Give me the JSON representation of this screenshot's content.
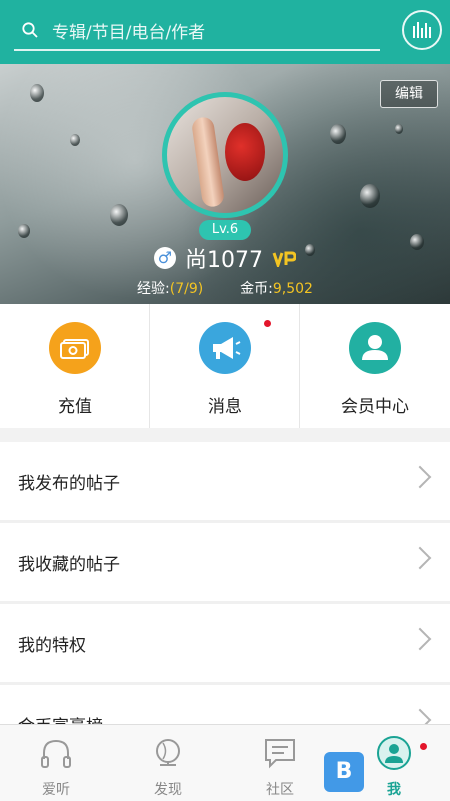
{
  "search": {
    "placeholder": "专辑/节目/电台/作者"
  },
  "profile": {
    "edit_label": "编辑",
    "level": "Lv.6",
    "username": "尚1077",
    "gender_symbol": "♂",
    "exp_label": "经验:",
    "exp_value": "(7/9)",
    "coins_label": "金币:",
    "coins_value": "9,502"
  },
  "quick_actions": [
    {
      "label": "充值",
      "icon": "wallet-icon",
      "color": "#f5a21b"
    },
    {
      "label": "消息",
      "icon": "megaphone-icon",
      "color": "#3aa6dd",
      "badge": true
    },
    {
      "label": "会员中心",
      "icon": "member-icon",
      "color": "#22b0a2"
    }
  ],
  "menu": [
    {
      "label": "我发布的帖子"
    },
    {
      "label": "我收藏的帖子"
    },
    {
      "label": "我的特权"
    },
    {
      "label": "金币富豪榜"
    }
  ],
  "bottom_nav": [
    {
      "label": "爱听",
      "icon": "headphones-icon",
      "active": false
    },
    {
      "label": "发现",
      "icon": "globe-icon",
      "active": false
    },
    {
      "label": "社区",
      "icon": "chat-icon",
      "active": false
    },
    {
      "label": "我",
      "icon": "user-icon",
      "active": true,
      "badge": true
    }
  ],
  "colors": {
    "accent": "#20b2a0",
    "gold": "#f3c423",
    "badge_red": "#e3162b"
  }
}
